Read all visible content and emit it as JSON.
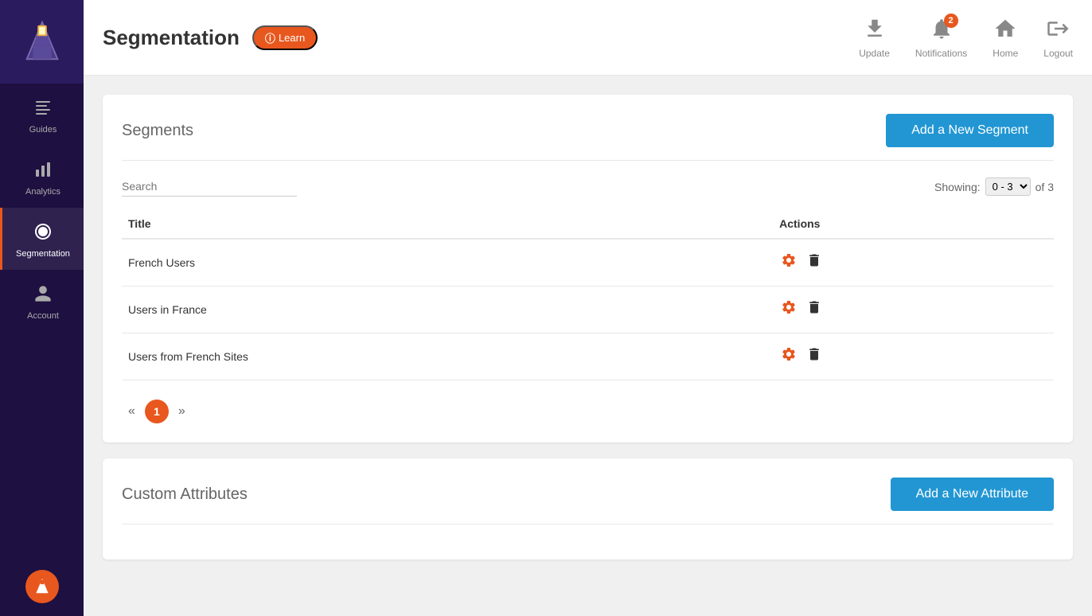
{
  "sidebar": {
    "logo_alt": "Lighthouse Logo",
    "items": [
      {
        "id": "guides",
        "label": "Guides",
        "icon": "☰",
        "active": false
      },
      {
        "id": "analytics",
        "label": "Analytics",
        "icon": "📊",
        "active": false
      },
      {
        "id": "segmentation",
        "label": "Segmentation",
        "icon": "⬤",
        "active": true
      },
      {
        "id": "account",
        "label": "Account",
        "icon": "👤",
        "active": false
      }
    ]
  },
  "header": {
    "title": "Segmentation",
    "learn_label": "Learn",
    "actions": [
      {
        "id": "update",
        "label": "Update",
        "icon": "upload"
      },
      {
        "id": "notifications",
        "label": "Notifications",
        "icon": "bell",
        "badge": "2"
      },
      {
        "id": "home",
        "label": "Home",
        "icon": "home"
      },
      {
        "id": "logout",
        "label": "Logout",
        "icon": "logout"
      }
    ]
  },
  "segments_card": {
    "title": "Segments",
    "add_button": "Add a New Segment",
    "search_placeholder": "Search",
    "showing_label": "Showing:",
    "showing_value": "0 - 3",
    "of_label": "of 3",
    "columns": [
      {
        "key": "title",
        "label": "Title"
      },
      {
        "key": "actions",
        "label": "Actions"
      }
    ],
    "rows": [
      {
        "id": 1,
        "title": "French Users"
      },
      {
        "id": 2,
        "title": "Users in France"
      },
      {
        "id": 3,
        "title": "Users from French Sites"
      }
    ],
    "pagination": {
      "prev": "«",
      "current": "1",
      "next": "»"
    }
  },
  "attributes_card": {
    "title": "Custom Attributes",
    "add_button": "Add a New Attribute"
  }
}
